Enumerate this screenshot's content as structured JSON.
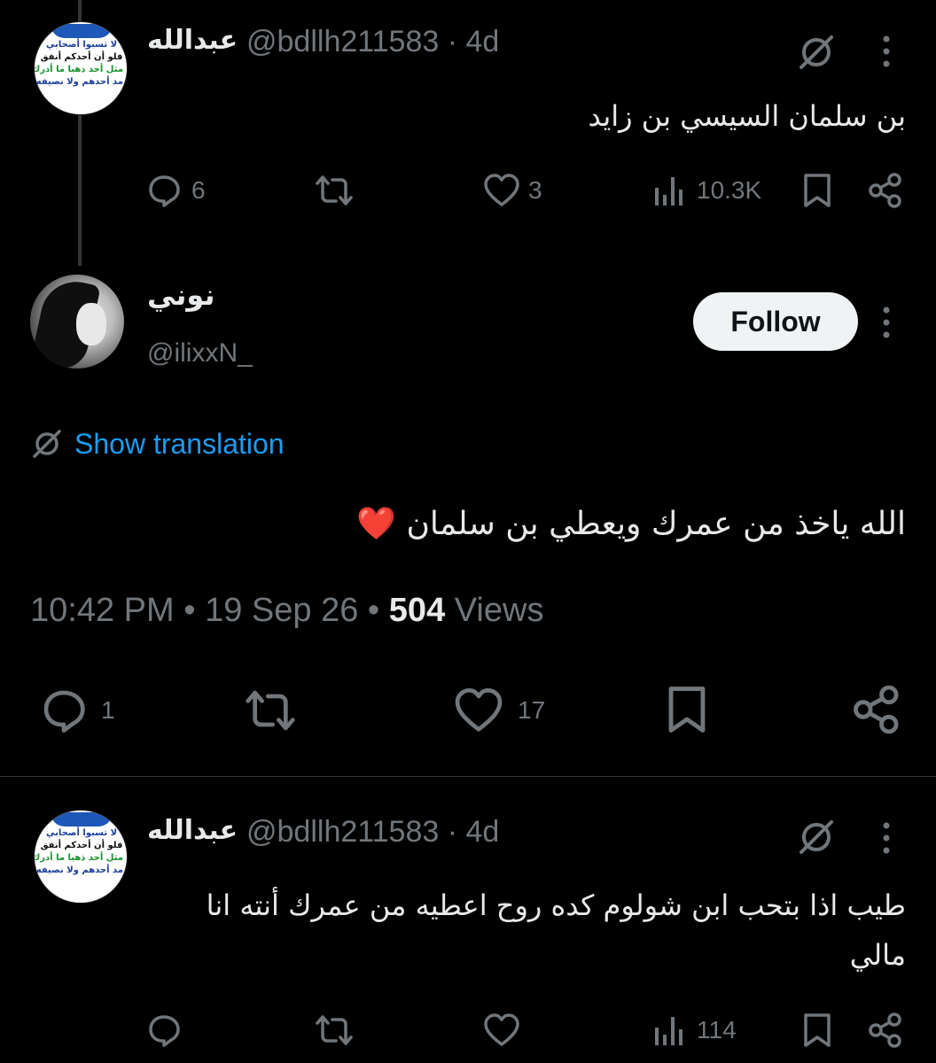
{
  "tweets": {
    "top": {
      "name": "عبدالله",
      "handle": "@bdllh211583",
      "time": "· 4d",
      "text": "بن سلمان السيسي بن زايد",
      "avatar_lines": [
        "لا تسبوا أصحابي",
        "فلو أن أحدكم أنفق",
        "مثل أحد ذهبا ما أدرك",
        "مد أحدهم ولا نصيفه"
      ],
      "replies": "6",
      "likes": "3",
      "views": "10.3K"
    },
    "main": {
      "name": "نوني",
      "handle": "@ilixxN_",
      "follow_label": "Follow",
      "show_translation": "Show translation",
      "text": "الله ياخذ من عمرك ويعطي بن سلمان ❤️",
      "timestamp": "10:42 PM",
      "date": "19 Sep 26",
      "views_count": "504",
      "views_label": "Views",
      "replies": "1",
      "likes": "17"
    },
    "bottom": {
      "name": "عبدالله",
      "handle": "@bdllh211583",
      "time": "· 4d",
      "text": "طيب اذا بتحب ابن شولوم كده روح اعطيه من عمرك أنته انا مالي",
      "avatar_lines": [
        "لا تسبوا أصحابي",
        "فلو أن أحدكم أنفق",
        "مثل أحد ذهبا ما أدرك",
        "مد أحدهم ولا نصيفه"
      ],
      "views": "114"
    }
  },
  "colors": {
    "background": "#000000",
    "text": "#e7e9ea",
    "muted": "#71767b",
    "link": "#1d9bf0",
    "heart": "#f91880"
  },
  "icons": [
    "grok-icon",
    "more-icon",
    "reply-icon",
    "retweet-icon",
    "like-icon",
    "views-icon",
    "bookmark-icon",
    "share-icon",
    "translate-icon",
    "heart-emoji"
  ]
}
